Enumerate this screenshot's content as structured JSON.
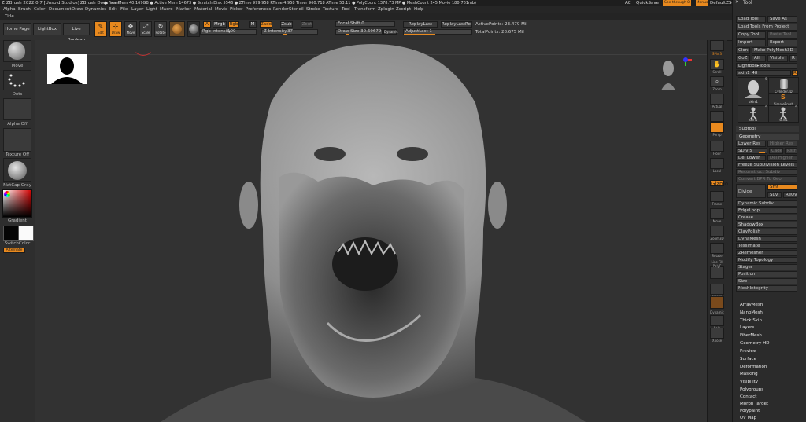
{
  "titlebar": {
    "app": "ZBrush 2022.0.7 [Unsold Studios]",
    "document": "ZBrush Document",
    "stats": "● Free Mem 40.169GB ● Active Mem 14673 ● Scratch Disk 5546 ● ZTime 999.958 RTime 4.958 Timer 960.718 ATime 53.11 ● PolyCount 1378.73 MP ● MeshCount 245 Movie 180(761mb)",
    "ac": "AC",
    "quicksave": "QuickSave",
    "see_through": "See-through 0",
    "menus_label": "Menus",
    "default_script": "DefaultZScript"
  },
  "menubar": [
    "Alpha",
    "Brush",
    "Color",
    "Document",
    "Draw",
    "Dynamics",
    "Edit",
    "File",
    "Layer",
    "Light",
    "Macro",
    "Marker",
    "Material",
    "Movie",
    "Picker",
    "Preferences",
    "Render",
    "Stencil",
    "Stroke",
    "Texture",
    "Tool",
    "Transform",
    "Zplugin",
    "Zscript",
    "Help"
  ],
  "tilebar": {
    "label": "Title"
  },
  "toolbar": {
    "home_page": "Home Page",
    "lightbox": "LightBox",
    "live_boolean": "Live Boolean",
    "edit": "Edit",
    "draw": "Draw",
    "move": "Move",
    "scale": "Scale",
    "rotate": "Rotate",
    "a": "A",
    "mrgb": "Mrgb",
    "rgb": "Rgb",
    "m": "M",
    "zadd": "Zadd",
    "zsub": "Zsub",
    "zcut": "Zcut",
    "rgb_intensity_label": "Rgb Intensity",
    "rgb_intensity_value": "100",
    "z_intensity_label": "Z Intensity",
    "z_intensity_value": "37",
    "focal_shift": "Focal Shift 0",
    "draw_size": "Draw Size 30.69679",
    "dynamic": "Dynamic",
    "replay_last": "ReplayLast",
    "replay_last_rel": "ReplayLastRel",
    "adjust_last": "AdjustLast 1",
    "active_points": "ActivePoints: 23.479 Mil",
    "total_points": "TotalPoints: 28.675 Mil"
  },
  "leftshelf": {
    "brush": "Move",
    "stroke": "Dots",
    "alpha": "Alpha Off",
    "texture": "Texture Off",
    "material": "MatCap Gray",
    "gradient": "Gradient",
    "switch_color": "SwitchColor",
    "alternate": "Alternate"
  },
  "rightshelf": [
    "SPix 3",
    "Scroll",
    "Zoom",
    "Actual",
    "AAHalf",
    "Persp",
    "Floor",
    "Local",
    "Gizmo",
    "Frame",
    "Move",
    "Zoom3D",
    "Rotate",
    "Line Fill PolyF",
    "Transp",
    "Dynamic",
    "Solo",
    "Xpose"
  ],
  "toolpanel": {
    "title": "Tool",
    "load_tool": "Load Tool",
    "save_as": "Save As",
    "load_from_project": "Load Tools From Project",
    "copy_tool": "Copy Tool",
    "paste_tool": "Paste Tool",
    "import": "Import",
    "export": "Export",
    "clone": "Clone",
    "make_polymesh": "Make PolyMesh3D",
    "goz": "GoZ",
    "all": "All",
    "visible": "Visible",
    "r": "R",
    "lightbox_tools": "Lightbox▸Tools",
    "skin_label": "skin1_48",
    "skin_value": "R",
    "thumbs": [
      "skin1",
      "Cylinder3D",
      "SimpleBrush",
      "skin1",
      "skin1"
    ],
    "thumb_counts": [
      "5",
      "",
      "",
      "5",
      "5"
    ],
    "subtool": "Subtool",
    "geometry": "Geometry",
    "lower_res": "Lower Res",
    "higher_res": "Higher Res",
    "sdiv": "SDiv 5",
    "cage": "Cage",
    "rstr": "Rstr",
    "del_lower": "Del Lower",
    "del_higher": "Del Higher",
    "freeze": "Freeze SubDivision Levels",
    "reconstruct": "Reconstruct Subdiv",
    "convert_bpr": "Convert BPR To Geo",
    "divide": "Divide",
    "smt": "Smt",
    "suv": "Suv",
    "reuv": "ReUV",
    "items": [
      "Dynamic Subdiv",
      "EdgeLoop",
      "Crease",
      "ShadowBox",
      "ClayPolish",
      "DynaMesh",
      "Tessimate",
      "ZRemesher",
      "Modify Topology",
      "Stager",
      "Position",
      "Size",
      "MeshIntegrity"
    ],
    "sections": [
      "ArrayMesh",
      "NanoMesh",
      "Thick Skin",
      "Layers",
      "FiberMesh",
      "Geometry HD",
      "Preview",
      "Surface",
      "Deformation",
      "Masking",
      "Visibility",
      "Polygroups",
      "Contact",
      "Morph Target",
      "Polypaint",
      "UV Map"
    ]
  },
  "colors": {
    "accent": "#e8891e",
    "background": "#2a2a2a",
    "canvas": "#323232"
  }
}
